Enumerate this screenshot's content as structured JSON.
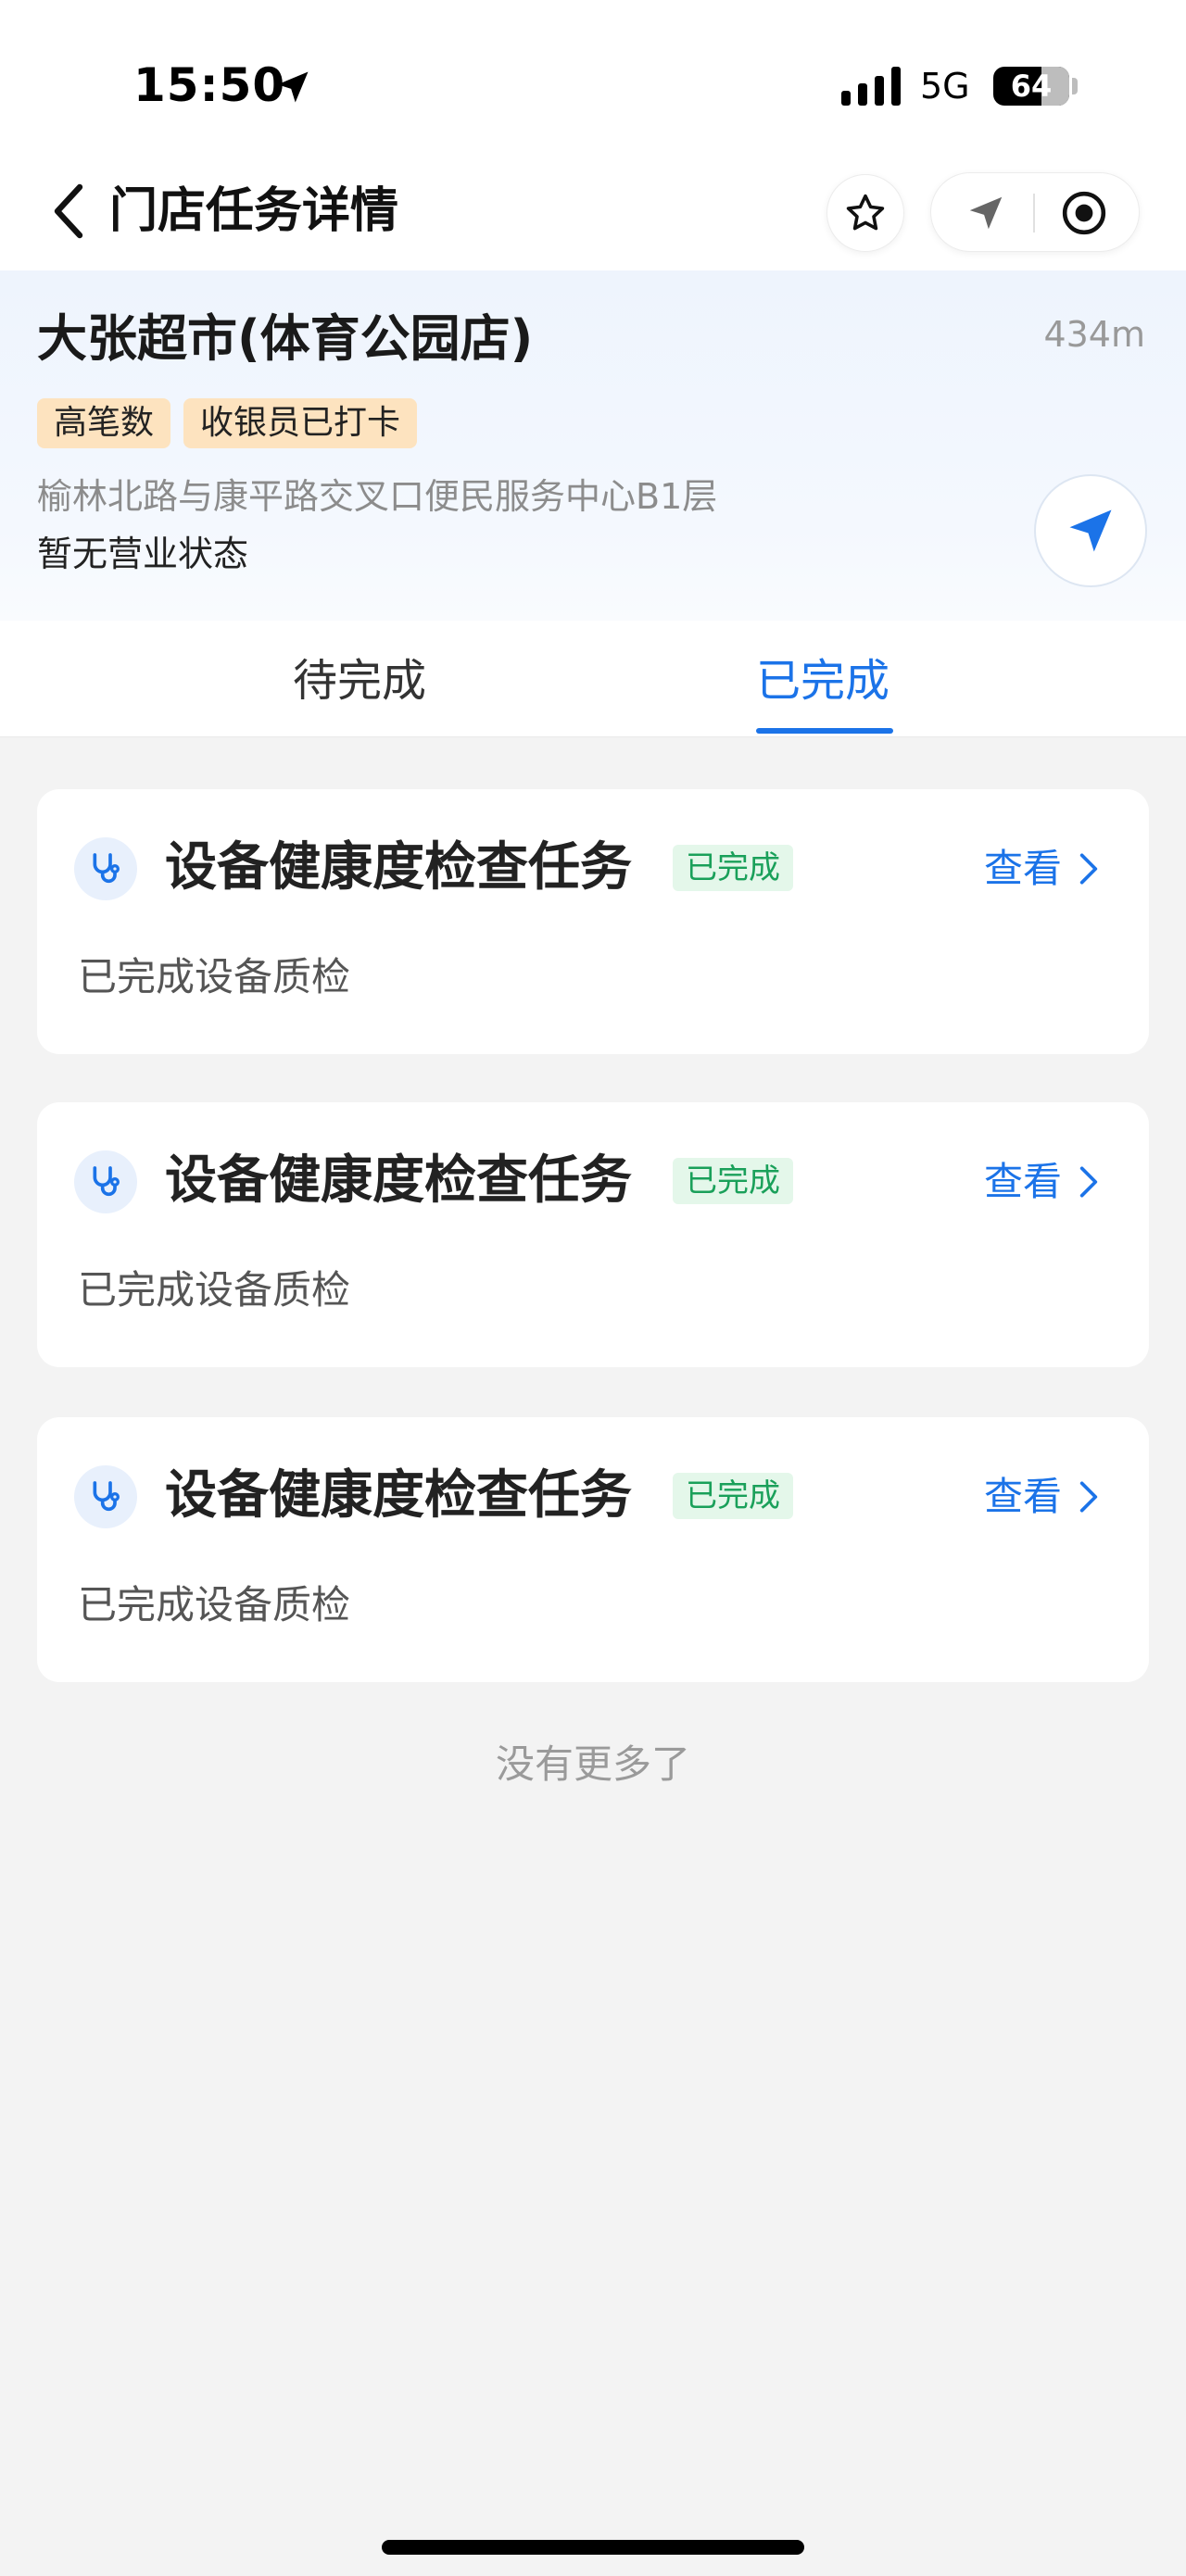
{
  "status_bar": {
    "time": "15:50",
    "network": "5G",
    "battery": "64",
    "battery_fraction": 0.64
  },
  "nav": {
    "title": "门店任务详情",
    "back_icon": "chevron-left-icon",
    "star_icon": "star-outline-icon",
    "location_icon": "navigation-arrow-icon",
    "target_icon": "record-target-icon"
  },
  "store": {
    "name": "大张超市(体育公园店)",
    "distance": "434m",
    "tags": [
      "高笔数",
      "收银员已打卡"
    ],
    "address": "榆林北路与康平路交叉口便民服务中心B1层",
    "business_status": "暂无营业状态",
    "navigate_icon": "navigation-arrow-icon"
  },
  "tabs": [
    {
      "label": "待完成",
      "active": false
    },
    {
      "label": "已完成",
      "active": true
    }
  ],
  "tasks": [
    {
      "icon": "stethoscope-icon",
      "title": "设备健康度检查任务",
      "badge": "已完成",
      "action": "查看",
      "description": "已完成设备质检"
    },
    {
      "icon": "stethoscope-icon",
      "title": "设备健康度检查任务",
      "badge": "已完成",
      "action": "查看",
      "description": "已完成设备质检"
    },
    {
      "icon": "stethoscope-icon",
      "title": "设备健康度检查任务",
      "badge": "已完成",
      "action": "查看",
      "description": "已完成设备质检"
    }
  ],
  "footer": {
    "no_more": "没有更多了"
  },
  "colors": {
    "accent": "#1b73e8",
    "tag_bg": "#fde3bf",
    "badge_bg": "#e4f7ea",
    "badge_text": "#1aa05a",
    "page_bg": "#f3f3f3"
  }
}
